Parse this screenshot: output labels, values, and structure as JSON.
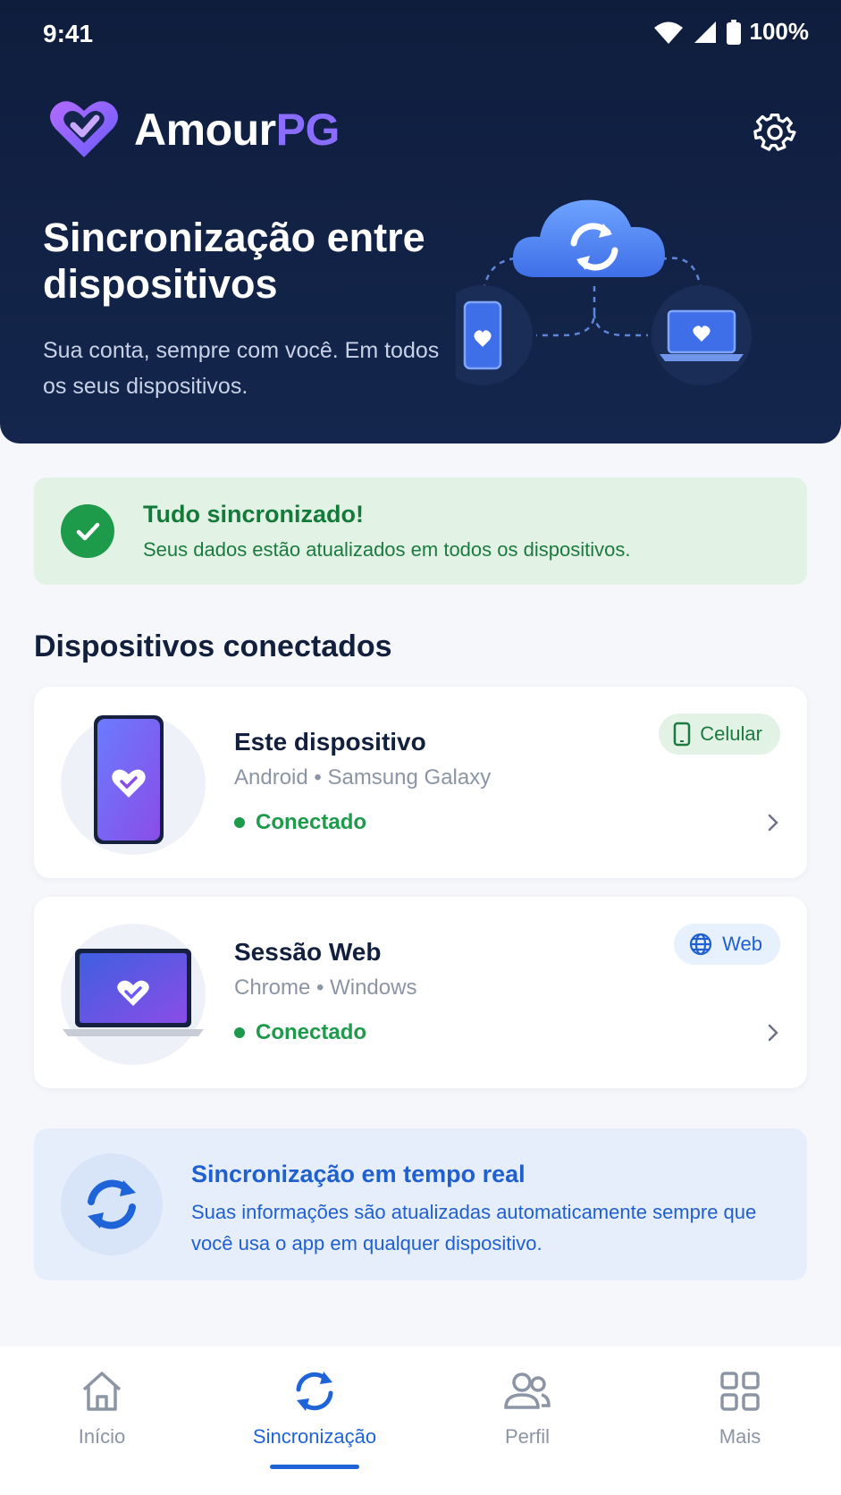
{
  "status_bar": {
    "time": "9:41",
    "battery": "100%"
  },
  "app": {
    "name_part1": "Amour",
    "name_part2": "PG"
  },
  "hero": {
    "title": "Sincronização entre dispositivos",
    "subtitle": "Sua conta, sempre com você. Em todos os seus dispositivos."
  },
  "sync_banner": {
    "title": "Tudo sincronizado!",
    "description": "Seus dados estão atualizados em todos os dispositivos."
  },
  "devices_section": {
    "title": "Dispositivos conectados"
  },
  "devices": [
    {
      "name": "Este dispositivo",
      "meta": "Android • Samsung Galaxy",
      "status": "Conectado",
      "badge": "Celular"
    },
    {
      "name": "Sessão Web",
      "meta": "Chrome • Windows",
      "status": "Conectado",
      "badge": "Web"
    }
  ],
  "realtime": {
    "title": "Sincronização em tempo real",
    "description": "Suas informações são atualizadas automaticamente sempre que você usa o app em qualquer dispositivo."
  },
  "nav": [
    {
      "label": "Início",
      "icon": "home-icon"
    },
    {
      "label": "Sincronização",
      "icon": "sync-icon",
      "active": true
    },
    {
      "label": "Perfil",
      "icon": "profile-icon"
    },
    {
      "label": "Mais",
      "icon": "grid-icon"
    }
  ],
  "colors": {
    "header_bg": "#0f1d3d",
    "accent_purple": "#8a6cff",
    "success_green": "#1e9a4b",
    "primary_blue": "#1f63d8"
  }
}
